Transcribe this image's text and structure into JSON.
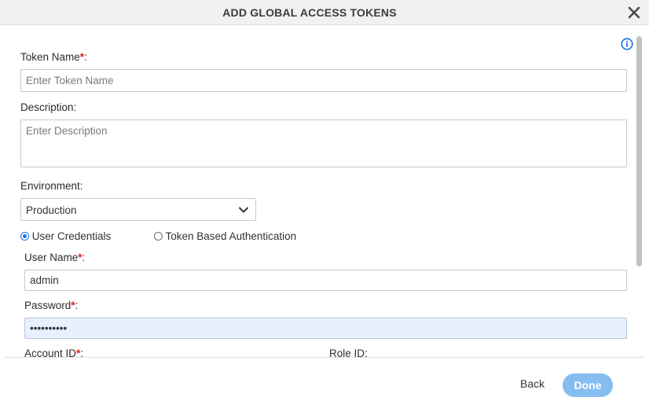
{
  "dialog": {
    "title": "ADD GLOBAL ACCESS TOKENS"
  },
  "form": {
    "token_name": {
      "label": "Token Name",
      "required_mark": "*",
      "suffix": ":",
      "placeholder": "Enter Token Name",
      "value": ""
    },
    "description": {
      "label": "Description:",
      "placeholder": "Enter Description",
      "value": ""
    },
    "environment": {
      "label": "Environment:",
      "selected": "Production"
    },
    "auth": {
      "options": [
        "User Credentials",
        "Token Based Authentication"
      ],
      "selected": "User Credentials"
    },
    "user_name": {
      "label": "User Name",
      "required_mark": "*",
      "suffix": ":",
      "value": "admin"
    },
    "password": {
      "label": "Password",
      "required_mark": "*",
      "suffix": ":",
      "value": "••••••••••"
    },
    "account_id": {
      "label": "Account ID",
      "required_mark": "*",
      "suffix": ":"
    },
    "role_id": {
      "label": "Role ID:"
    }
  },
  "footer": {
    "back_label": "Back",
    "done_label": "Done"
  },
  "colors": {
    "accent": "#1a73e8",
    "required": "#e21a1a",
    "done_button": "#86bdf0",
    "autofill": "#e8f0fe"
  },
  "icons": {
    "close": "close-icon",
    "info": "info-icon",
    "dropdown": "chevron-down-icon"
  }
}
